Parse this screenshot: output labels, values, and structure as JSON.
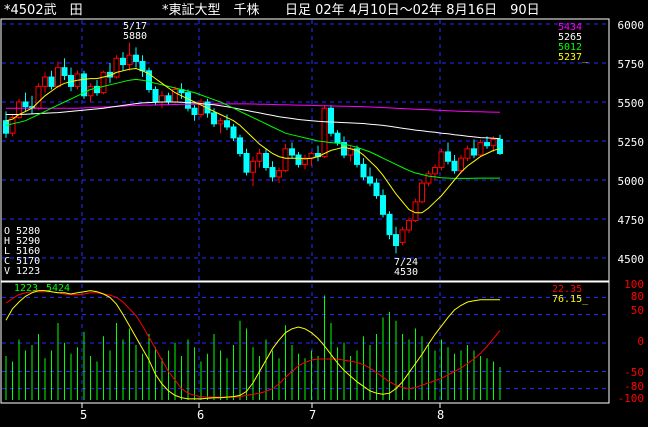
{
  "header": {
    "code": "*4502武　田",
    "market": "*東証大型　千株",
    "period": "日足 02年 4月10日～02年 8月16日　90日"
  },
  "price_panel": {
    "y_ticks": [
      "6000",
      "5750",
      "5500",
      "5250",
      "5000",
      "4750",
      "4500"
    ],
    "legend_values": [
      "5434",
      "5265",
      "5012",
      "5237_"
    ],
    "legend_colors": [
      "#ff00ff",
      "#ffffff",
      "#00ff00",
      "#ffff00"
    ],
    "ohlcv": [
      "O 5280",
      "H 5290",
      "L 5160",
      "C 5170",
      "V 1223"
    ],
    "high_date": "5/17",
    "high_value": "5880",
    "low_date": "7/24",
    "low_value": "4530"
  },
  "volume_panel": {
    "values": [
      "1223",
      "5424"
    ]
  },
  "oscillator_panel": {
    "y_ticks": [
      "100",
      "80",
      "50",
      "0",
      "-50",
      "-80",
      "-100"
    ],
    "legend_values": [
      "22.35",
      "76.15_"
    ],
    "legend_colors": [
      "#ff0000",
      "#ffff00"
    ]
  },
  "x_axis": {
    "month_labels": [
      "5",
      "6",
      "7",
      "8"
    ]
  },
  "colors": {
    "up": "#ff0000",
    "down": "#00ffff",
    "grid": "#2a2aff",
    "text": "#ffffff",
    "volume": "#00ff00"
  },
  "chart_data": {
    "type": "candlestick",
    "title": "*4502武　田 *東証大型　千株 日足 02年 4月10日～02年 8月16日　90日",
    "ylim": [
      4400,
      6000
    ],
    "candles": [
      [
        5380,
        5440,
        5270,
        5300
      ],
      [
        5300,
        5420,
        5280,
        5400
      ],
      [
        5400,
        5520,
        5390,
        5500
      ],
      [
        5500,
        5560,
        5440,
        5470
      ],
      [
        5470,
        5540,
        5420,
        5460
      ],
      [
        5460,
        5620,
        5450,
        5600
      ],
      [
        5600,
        5690,
        5560,
        5660
      ],
      [
        5660,
        5700,
        5580,
        5600
      ],
      [
        5600,
        5760,
        5590,
        5720
      ],
      [
        5720,
        5780,
        5640,
        5670
      ],
      [
        5670,
        5720,
        5570,
        5600
      ],
      [
        5600,
        5700,
        5580,
        5680
      ],
      [
        5680,
        5700,
        5520,
        5540
      ],
      [
        5540,
        5620,
        5500,
        5600
      ],
      [
        5600,
        5640,
        5540,
        5560
      ],
      [
        5560,
        5700,
        5550,
        5690
      ],
      [
        5690,
        5750,
        5620,
        5660
      ],
      [
        5660,
        5800,
        5650,
        5780
      ],
      [
        5780,
        5820,
        5700,
        5740
      ],
      [
        5740,
        5880,
        5700,
        5800
      ],
      [
        5800,
        5850,
        5720,
        5760
      ],
      [
        5760,
        5800,
        5660,
        5700
      ],
      [
        5700,
        5720,
        5560,
        5580
      ],
      [
        5580,
        5600,
        5480,
        5500
      ],
      [
        5500,
        5570,
        5460,
        5540
      ],
      [
        5540,
        5560,
        5480,
        5500
      ],
      [
        5500,
        5600,
        5490,
        5580
      ],
      [
        5580,
        5620,
        5520,
        5560
      ],
      [
        5560,
        5580,
        5440,
        5460
      ],
      [
        5460,
        5480,
        5380,
        5420
      ],
      [
        5420,
        5520,
        5400,
        5500
      ],
      [
        5500,
        5520,
        5400,
        5430
      ],
      [
        5430,
        5460,
        5340,
        5360
      ],
      [
        5360,
        5400,
        5300,
        5380
      ],
      [
        5380,
        5420,
        5320,
        5340
      ],
      [
        5340,
        5360,
        5250,
        5270
      ],
      [
        5270,
        5290,
        5150,
        5170
      ],
      [
        5170,
        5200,
        5030,
        5050
      ],
      [
        5050,
        5150,
        4960,
        5120
      ],
      [
        5120,
        5200,
        5080,
        5170
      ],
      [
        5170,
        5200,
        5060,
        5080
      ],
      [
        5080,
        5120,
        4990,
        5020
      ],
      [
        5020,
        5080,
        4980,
        5060
      ],
      [
        5060,
        5230,
        5050,
        5200
      ],
      [
        5200,
        5240,
        5140,
        5160
      ],
      [
        5160,
        5180,
        5080,
        5100
      ],
      [
        5100,
        5160,
        5070,
        5140
      ],
      [
        5140,
        5180,
        5090,
        5170
      ],
      [
        5170,
        5220,
        5120,
        5150
      ],
      [
        5150,
        5480,
        5140,
        5460
      ],
      [
        5460,
        5480,
        5280,
        5300
      ],
      [
        5300,
        5320,
        5220,
        5240
      ],
      [
        5240,
        5280,
        5140,
        5160
      ],
      [
        5160,
        5220,
        5120,
        5200
      ],
      [
        5200,
        5220,
        5080,
        5100
      ],
      [
        5100,
        5140,
        5000,
        5020
      ],
      [
        5020,
        5080,
        4960,
        4980
      ],
      [
        4980,
        5010,
        4880,
        4900
      ],
      [
        4900,
        4940,
        4760,
        4780
      ],
      [
        4780,
        4800,
        4620,
        4650
      ],
      [
        4650,
        4700,
        4530,
        4580
      ],
      [
        4600,
        4700,
        4580,
        4680
      ],
      [
        4680,
        4760,
        4660,
        4740
      ],
      [
        4740,
        4880,
        4730,
        4860
      ],
      [
        4860,
        5000,
        4850,
        4980
      ],
      [
        4980,
        5060,
        4960,
        5040
      ],
      [
        5040,
        5100,
        5000,
        5080
      ],
      [
        5080,
        5200,
        5060,
        5180
      ],
      [
        5180,
        5240,
        5100,
        5120
      ],
      [
        5120,
        5160,
        5040,
        5060
      ],
      [
        5060,
        5160,
        5040,
        5140
      ],
      [
        5140,
        5220,
        5120,
        5200
      ],
      [
        5200,
        5260,
        5140,
        5160
      ],
      [
        5160,
        5260,
        5150,
        5240
      ],
      [
        5240,
        5280,
        5200,
        5220
      ],
      [
        5220,
        5280,
        5180,
        5260
      ],
      [
        5260,
        5290,
        5160,
        5170
      ]
    ],
    "ma_short": [
      5380,
      5390,
      5420,
      5440,
      5460,
      5500,
      5540,
      5570,
      5600,
      5620,
      5630,
      5640,
      5645,
      5650,
      5650,
      5660,
      5670,
      5690,
      5700,
      5710,
      5715,
      5700,
      5680,
      5650,
      5620,
      5590,
      5560,
      5540,
      5520,
      5500,
      5480,
      5460,
      5440,
      5420,
      5400,
      5380,
      5350,
      5310,
      5270,
      5230,
      5200,
      5170,
      5150,
      5140,
      5140,
      5140,
      5135,
      5140,
      5150,
      5170,
      5190,
      5200,
      5210,
      5200,
      5190,
      5160,
      5120,
      5080,
      5030,
      4970,
      4910,
      4860,
      4810,
      4790,
      4790,
      4820,
      4860,
      4900,
      4950,
      5000,
      5050,
      5090,
      5120,
      5150,
      5170,
      5190,
      5200
    ],
    "ma_mid": [
      5350,
      5360,
      5370,
      5380,
      5400,
      5420,
      5440,
      5460,
      5480,
      5500,
      5520,
      5540,
      5560,
      5580,
      5590,
      5600,
      5610,
      5620,
      5630,
      5640,
      5645,
      5640,
      5630,
      5620,
      5610,
      5600,
      5590,
      5580,
      5570,
      5560,
      5545,
      5530,
      5515,
      5500,
      5480,
      5460,
      5440,
      5420,
      5400,
      5380,
      5360,
      5340,
      5320,
      5300,
      5290,
      5280,
      5270,
      5260,
      5250,
      5245,
      5240,
      5235,
      5230,
      5220,
      5210,
      5195,
      5180,
      5160,
      5140,
      5120,
      5100,
      5080,
      5060,
      5045,
      5035,
      5025,
      5020,
      5015,
      5012,
      5010,
      5010,
      5010,
      5011,
      5012,
      5012,
      5012,
      5012
    ],
    "ma_long": [
      5460,
      5460,
      5460,
      5460,
      5460,
      5460,
      5460,
      5460,
      5460,
      5460,
      5460,
      5460,
      5462,
      5464,
      5466,
      5468,
      5470,
      5472,
      5474,
      5476,
      5478,
      5480,
      5480,
      5481,
      5482,
      5483,
      5484,
      5485,
      5486,
      5486,
      5487,
      5487,
      5488,
      5488,
      5488,
      5488,
      5488,
      5488,
      5487,
      5486,
      5485,
      5484,
      5483,
      5482,
      5481,
      5480,
      5479,
      5478,
      5477,
      5476,
      5475,
      5474,
      5473,
      5472,
      5471,
      5470,
      5468,
      5466,
      5464,
      5462,
      5460,
      5458,
      5456,
      5454,
      5452,
      5450,
      5448,
      5446,
      5444,
      5442,
      5440,
      5439,
      5438,
      5437,
      5436,
      5435,
      5434
    ],
    "ma_white": [
      5420,
      5420,
      5420,
      5422,
      5424,
      5426,
      5428,
      5430,
      5432,
      5436,
      5440,
      5444,
      5448,
      5452,
      5456,
      5460,
      5466,
      5472,
      5478,
      5484,
      5490,
      5494,
      5496,
      5498,
      5500,
      5500,
      5500,
      5498,
      5496,
      5494,
      5490,
      5486,
      5482,
      5476,
      5470,
      5462,
      5454,
      5446,
      5438,
      5430,
      5422,
      5414,
      5406,
      5400,
      5394,
      5388,
      5384,
      5380,
      5376,
      5374,
      5372,
      5370,
      5368,
      5366,
      5364,
      5362,
      5358,
      5354,
      5350,
      5344,
      5338,
      5332,
      5326,
      5320,
      5316,
      5310,
      5306,
      5300,
      5296,
      5290,
      5286,
      5280,
      5276,
      5272,
      5270,
      5267,
      5265
    ],
    "volume": [
      40,
      35,
      55,
      45,
      50,
      60,
      38,
      45,
      70,
      52,
      42,
      48,
      62,
      40,
      35,
      58,
      45,
      70,
      55,
      65,
      50,
      42,
      60,
      48,
      38,
      45,
      52,
      40,
      55,
      48,
      35,
      42,
      60,
      45,
      38,
      50,
      72,
      65,
      48,
      40,
      55,
      45,
      38,
      68,
      50,
      42,
      38,
      45,
      40,
      95,
      70,
      48,
      52,
      40,
      45,
      58,
      50,
      60,
      75,
      80,
      72,
      60,
      55,
      65,
      58,
      50,
      45,
      55,
      48,
      42,
      45,
      50,
      45,
      40,
      38,
      35,
      30
    ],
    "osc_red": [
      70,
      78,
      85,
      88,
      90,
      90,
      90,
      90,
      88,
      86,
      85,
      85,
      86,
      88,
      88,
      86,
      84,
      80,
      72,
      60,
      48,
      30,
      10,
      -10,
      -30,
      -50,
      -65,
      -80,
      -88,
      -92,
      -94,
      -95,
      -95,
      -95,
      -95,
      -95,
      -94,
      -92,
      -90,
      -88,
      -85,
      -80,
      -72,
      -60,
      -50,
      -40,
      -34,
      -30,
      -28,
      -28,
      -28,
      -28,
      -30,
      -32,
      -34,
      -38,
      -44,
      -52,
      -60,
      -68,
      -74,
      -78,
      -80,
      -78,
      -74,
      -70,
      -66,
      -62,
      -56,
      -50,
      -44,
      -36,
      -28,
      -18,
      -6,
      8,
      22
    ],
    "osc_yellow": [
      40,
      60,
      72,
      82,
      88,
      92,
      92,
      90,
      88,
      88,
      86,
      88,
      90,
      92,
      90,
      86,
      80,
      68,
      50,
      30,
      10,
      -10,
      -30,
      -55,
      -72,
      -84,
      -92,
      -96,
      -98,
      -98,
      -98,
      -97,
      -96,
      -96,
      -95,
      -94,
      -92,
      -85,
      -70,
      -50,
      -30,
      -10,
      5,
      18,
      25,
      28,
      25,
      18,
      8,
      -5,
      -20,
      -35,
      -48,
      -58,
      -68,
      -76,
      -84,
      -88,
      -90,
      -88,
      -80,
      -68,
      -52,
      -36,
      -20,
      -2,
      15,
      30,
      45,
      58,
      66,
      72,
      74,
      76,
      76,
      76,
      76
    ]
  }
}
